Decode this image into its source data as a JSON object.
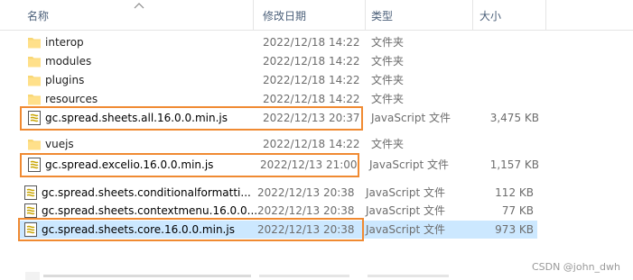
{
  "header": {
    "col_name": "名称",
    "col_date": "修改日期",
    "col_type": "类型",
    "col_size": "大小"
  },
  "rows": [
    {
      "name": "interop",
      "date": "2022/12/18 14:22",
      "type": "文件夹",
      "size": "",
      "icon": "folder-icon"
    },
    {
      "name": "modules",
      "date": "2022/12/18 14:22",
      "type": "文件夹",
      "size": "",
      "icon": "folder-icon"
    },
    {
      "name": "plugins",
      "date": "2022/12/18 14:22",
      "type": "文件夹",
      "size": "",
      "icon": "folder-icon"
    },
    {
      "name": "resources",
      "date": "2022/12/18 14:22",
      "type": "文件夹",
      "size": "",
      "icon": "folder-icon"
    },
    {
      "name": "gc.spread.sheets.all.16.0.0.min.js",
      "date": "2022/12/13 20:37",
      "type": "JavaScript 文件",
      "size": "3,475 KB",
      "icon": "js-file-icon"
    },
    {
      "name": "vuejs",
      "date": "2022/12/18 14:22",
      "type": "文件夹",
      "size": "",
      "icon": "folder-icon"
    },
    {
      "name": "gc.spread.excelio.16.0.0.min.js",
      "date": "2022/12/13 21:00",
      "type": "JavaScript 文件",
      "size": "1,157 KB",
      "icon": "js-file-icon"
    },
    {
      "name": "gc.spread.sheets.conditionalformatti...",
      "date": "2022/12/13 20:38",
      "type": "JavaScript 文件",
      "size": "112 KB",
      "icon": "js-file-icon"
    },
    {
      "name": "gc.spread.sheets.contextmenu.16.0.0....",
      "date": "2022/12/13 20:38",
      "type": "JavaScript 文件",
      "size": "77 KB",
      "icon": "js-file-icon"
    },
    {
      "name": "gc.spread.sheets.core.16.0.0.min.js",
      "date": "2022/12/13 20:38",
      "type": "JavaScript 文件",
      "size": "973 KB",
      "icon": "js-file-icon",
      "selected": true
    }
  ],
  "watermark": "CSDN @john_dwh",
  "colors": {
    "highlight_border": "#f08a32",
    "selection": "#cce8ff",
    "header_text": "#4c607a"
  }
}
